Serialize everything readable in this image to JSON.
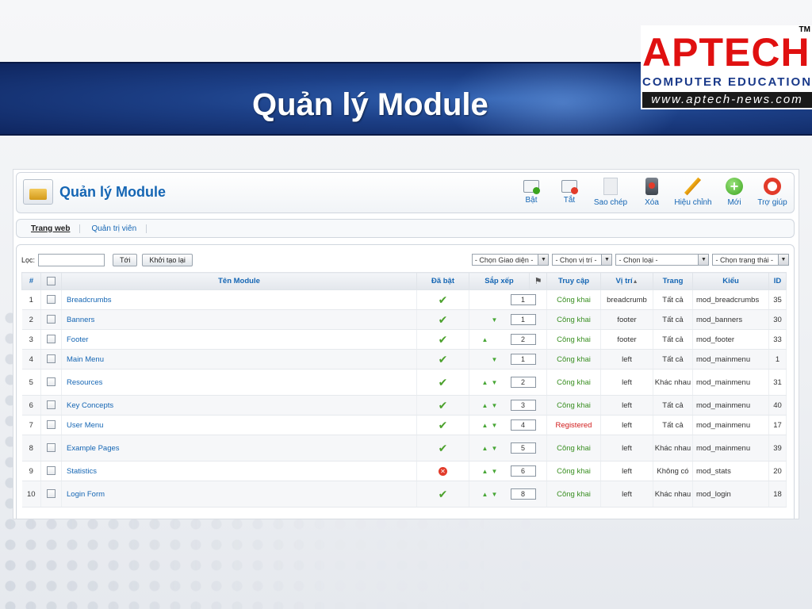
{
  "slide": {
    "title": "Quản lý Module"
  },
  "logo": {
    "brand": "APTECH",
    "tm": "TM",
    "tagline": "COMPUTER EDUCATION",
    "url": "www.aptech-news.com"
  },
  "panel": {
    "title": "Quản lý Module",
    "icon": "modules-icon"
  },
  "toolbar": {
    "buttons": [
      {
        "label": "Bật",
        "icon": "enable-icon"
      },
      {
        "label": "Tắt",
        "icon": "disable-icon"
      },
      {
        "label": "Sao chép",
        "icon": "copy-icon"
      },
      {
        "label": "Xóa",
        "icon": "trash-icon"
      },
      {
        "label": "Hiệu chỉnh",
        "icon": "pencil-icon"
      },
      {
        "label": "Mới",
        "icon": "plus-icon"
      },
      {
        "label": "Trợ giúp",
        "icon": "help-icon"
      }
    ]
  },
  "tabs": [
    {
      "label": "Trang web",
      "active": true
    },
    {
      "label": "Quản trị viên",
      "active": false
    }
  ],
  "filter": {
    "label": "Lọc:",
    "input_value": "",
    "go_label": "Tới",
    "reset_label": "Khởi tạo lại",
    "selects": [
      "- Chọn Giao diện -",
      "- Chọn vị trí -",
      "- Chọn loại -",
      "- Chọn trạng thái -"
    ]
  },
  "table": {
    "columns": [
      "#",
      "",
      "Tên Module",
      "Đã bật",
      "Sắp xếp",
      "",
      "Truy cập",
      "Vị trí",
      "Trang",
      "Kiểu",
      "ID"
    ],
    "rows": [
      {
        "n": "1",
        "name": "Breadcrumbs",
        "enabled": true,
        "up": false,
        "down": false,
        "order": "1",
        "access": "Công khai",
        "position": "breadcrumb",
        "pages": "Tất cả",
        "type": "mod_breadcrumbs",
        "id": "35"
      },
      {
        "n": "2",
        "name": "Banners",
        "enabled": true,
        "up": false,
        "down": true,
        "order": "1",
        "access": "Công khai",
        "position": "footer",
        "pages": "Tất cả",
        "type": "mod_banners",
        "id": "30"
      },
      {
        "n": "3",
        "name": "Footer",
        "enabled": true,
        "up": true,
        "down": false,
        "order": "2",
        "access": "Công khai",
        "position": "footer",
        "pages": "Tất cả",
        "type": "mod_footer",
        "id": "33"
      },
      {
        "n": "4",
        "name": "Main Menu",
        "enabled": true,
        "up": false,
        "down": true,
        "order": "1",
        "access": "Công khai",
        "position": "left",
        "pages": "Tất cả",
        "type": "mod_mainmenu",
        "id": "1"
      },
      {
        "n": "5",
        "name": "Resources",
        "enabled": true,
        "up": true,
        "down": true,
        "order": "2",
        "access": "Công khai",
        "position": "left",
        "pages": "Khác nhau",
        "type": "mod_mainmenu",
        "id": "31"
      },
      {
        "n": "6",
        "name": "Key Concepts",
        "enabled": true,
        "up": true,
        "down": true,
        "order": "3",
        "access": "Công khai",
        "position": "left",
        "pages": "Tất cả",
        "type": "mod_mainmenu",
        "id": "40"
      },
      {
        "n": "7",
        "name": "User Menu",
        "enabled": true,
        "up": true,
        "down": true,
        "order": "4",
        "access": "Registered",
        "position": "left",
        "pages": "Tất cả",
        "type": "mod_mainmenu",
        "id": "17"
      },
      {
        "n": "8",
        "name": "Example Pages",
        "enabled": true,
        "up": true,
        "down": true,
        "order": "5",
        "access": "Công khai",
        "position": "left",
        "pages": "Khác nhau",
        "type": "mod_mainmenu",
        "id": "39"
      },
      {
        "n": "9",
        "name": "Statistics",
        "enabled": false,
        "up": true,
        "down": true,
        "order": "6",
        "access": "Công khai",
        "position": "left",
        "pages": "Không có",
        "type": "mod_stats",
        "id": "20"
      },
      {
        "n": "10",
        "name": "Login Form",
        "enabled": true,
        "up": true,
        "down": true,
        "order": "8",
        "access": "Công khai",
        "position": "left",
        "pages": "Khác nhau",
        "type": "mod_login",
        "id": "18"
      }
    ]
  },
  "colors": {
    "link": "#1566b4",
    "enabled": "#4ca12d",
    "disabled": "#e23b2a",
    "registered": "#d11b1b",
    "banner": "#1c3f86"
  }
}
